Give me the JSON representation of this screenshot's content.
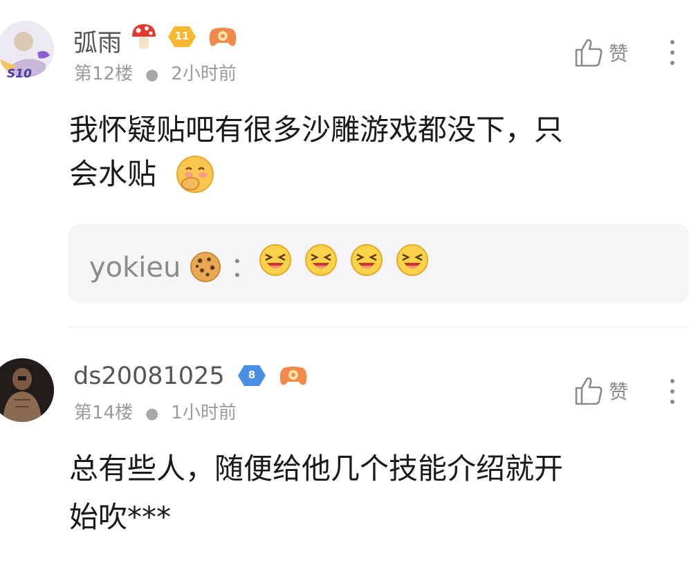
{
  "posts": [
    {
      "username": "弧雨",
      "level": "11",
      "floor": "第12楼",
      "time": "2小时前",
      "like_label": "赞",
      "content_line1": "我怀疑贴吧有很多沙雕游戏都没下，只",
      "content_line2": "会水贴",
      "avatar_tag": "S10",
      "reply": {
        "name": "yokieu",
        "separator": "："
      }
    },
    {
      "username": "ds20081025",
      "level": "8",
      "floor": "第14楼",
      "time": "1小时前",
      "like_label": "赞",
      "content_line1": "总有些人，随便给他几个技能介绍就开",
      "content_line2": "始吹***"
    }
  ],
  "colors": {
    "gold_badge": "#f5b82e",
    "blue_badge": "#4a90e2",
    "game_badge": "#f08a4b",
    "reply_bg": "#f5f5f7"
  }
}
